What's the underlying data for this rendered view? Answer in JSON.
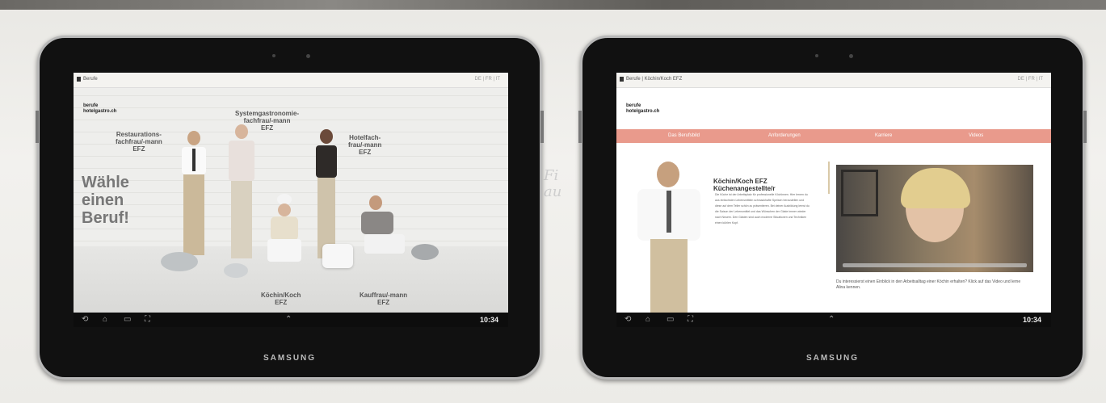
{
  "tablet1": {
    "brand": "SAMSUNG",
    "tab_title": "Berufe",
    "tab_right": "DE | FR | IT",
    "logo_line1": "berufe",
    "logo_line2": "hotelgastro.ch",
    "headline_lines": [
      "Wähle",
      "einen",
      "Beruf!"
    ],
    "labels": {
      "restaurant": "Restaurations-\nfachfrau/-mann\nEFZ",
      "system": "Systemgastronomie-\nfachfrau/-mann\nEFZ",
      "hotel": "Hotelfach-\nfrau/-mann\nEFZ",
      "koch": "Köchin/Koch\nEFZ",
      "kauf": "Kauffrau/-mann\nEFZ"
    },
    "status_time": "10:34"
  },
  "tablet2": {
    "brand": "SAMSUNG",
    "tab_title": "Berufe | Köchin/Koch EFZ",
    "tab_right": "DE | FR | IT",
    "logo_line1": "berufe",
    "logo_line2": "hotelgastro.ch",
    "nav": [
      "Das Berufsbild",
      "Anforderungen",
      "Karriere",
      "Videos"
    ],
    "heading_line1": "Köchin/Koch EFZ",
    "heading_line2": "Küchenangestellte/r",
    "paragraph": "Die Küche ist der Arbeitsplatz für professionelle Köchinnen. Hier lernen du aus einfachsten Lebensmitteln schmackhafte Speisen herzustellen und diese auf dem Teller schön zu präsentieren. Bei deiner Ausbildung lernst du die Saison der Lebensmittel und das Wünschen der Gäste immer wieder nach Neuem. Den Gästen sind auch moderne Situationen und Techniken einen kühlen Kopf.",
    "caption": "Du interessierst einen Einblick in den Arbeitsalltag einer Köchin erhalten? Klick auf das Video und lerne Alina kennen.",
    "status_time": "10:34"
  },
  "background_handwriting": "Fi\nau"
}
